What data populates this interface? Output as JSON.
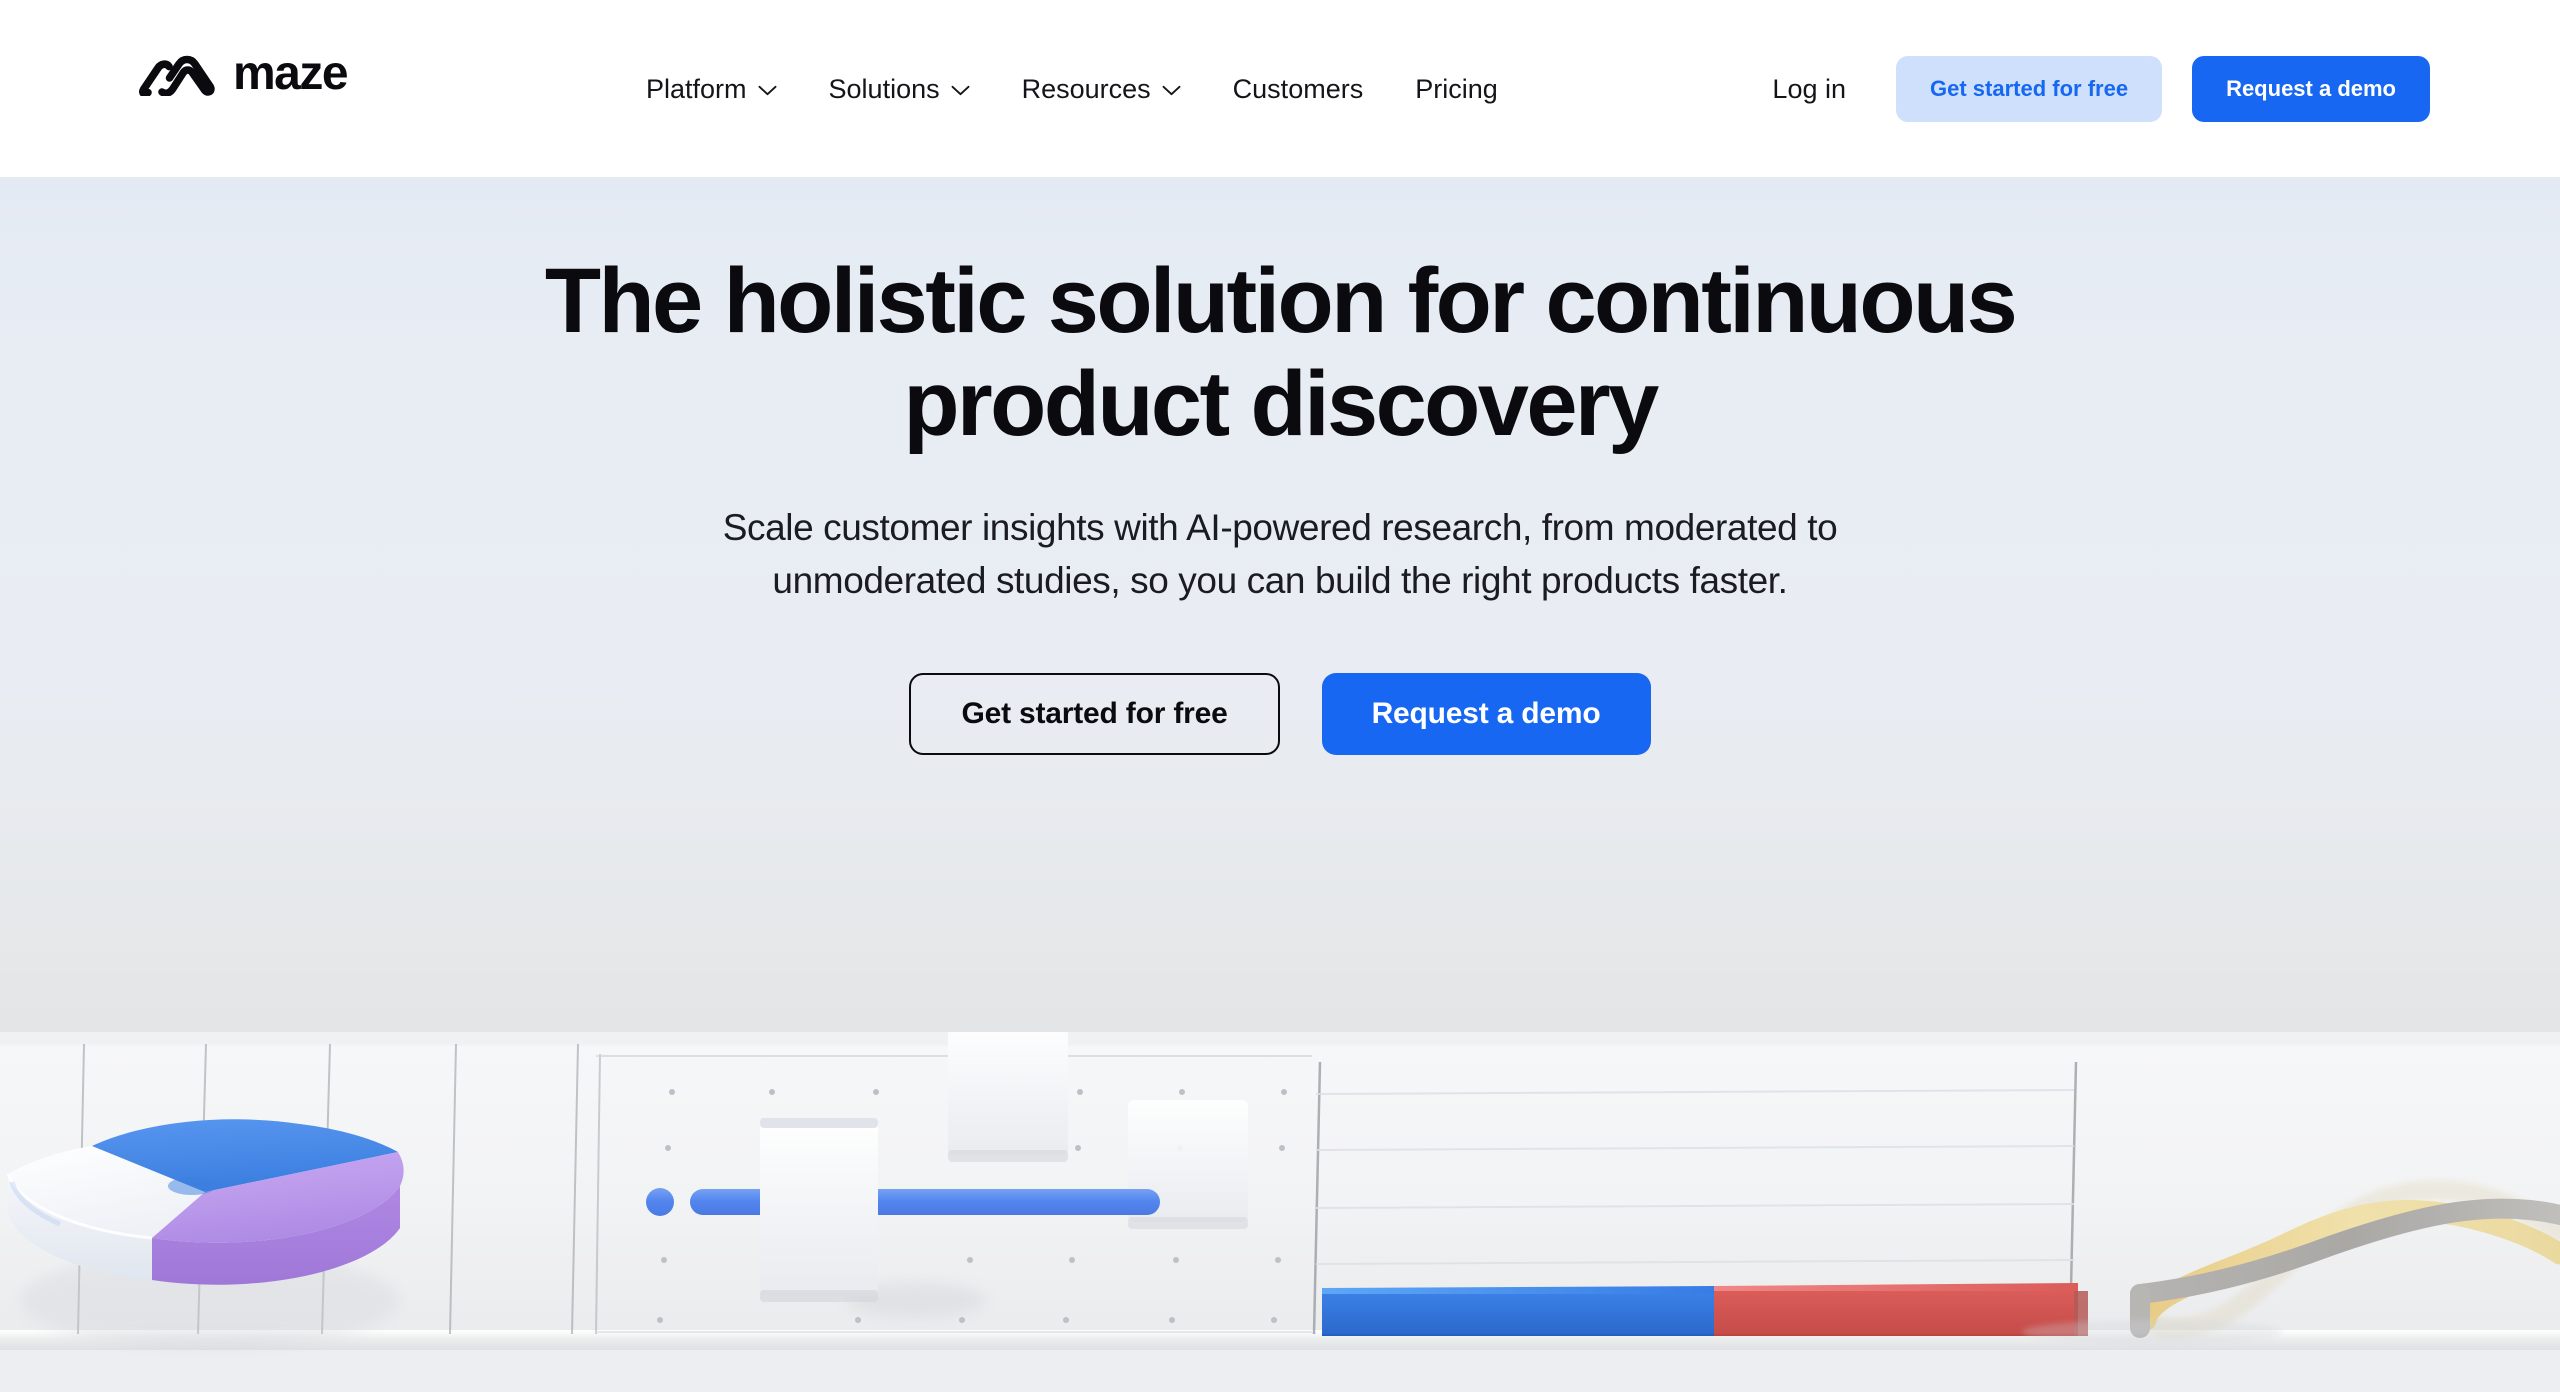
{
  "brand": {
    "name": "maze",
    "logo_icon": "maze-logo-icon",
    "accent_blue": "#1767f2",
    "soft_blue_bg": "#cfe0fd",
    "soft_blue_text": "#1668f0",
    "text_dark": "#0b0b0f",
    "hero_bg_top": "#e8edf4"
  },
  "header": {
    "nav_items": [
      {
        "label": "Platform",
        "has_dropdown": true,
        "icon": "chevron-down-icon"
      },
      {
        "label": "Solutions",
        "has_dropdown": true,
        "icon": "chevron-down-icon"
      },
      {
        "label": "Resources",
        "has_dropdown": true,
        "icon": "chevron-down-icon"
      },
      {
        "label": "Customers",
        "has_dropdown": false,
        "icon": ""
      },
      {
        "label": "Pricing",
        "has_dropdown": false,
        "icon": ""
      }
    ],
    "login_label": "Log in",
    "get_started_label": "Get started for free",
    "request_demo_label": "Request a demo"
  },
  "hero": {
    "title_line_1": "The holistic solution for continuous",
    "title_line_2": "product discovery",
    "subtitle_line_1": "Scale customer insights with AI-powered research, from moderated to",
    "subtitle_line_2": "unmoderated studies, so you can build the right products faster.",
    "cta_primary_outline": "Get started for free",
    "cta_primary_filled": "Request a demo"
  },
  "illustration": {
    "description": "3D render of abstract research data visualizations on a white platform",
    "elements": [
      {
        "name": "pie-chart-3d",
        "colors": [
          "#3f86e8",
          "#b08ce6",
          "#f4f5f7"
        ]
      },
      {
        "name": "slider-control-3d",
        "colors": [
          "#4d82ea",
          "#eef1f6"
        ]
      },
      {
        "name": "stacked-bar-chart-3d",
        "colors": [
          "#1b68e0",
          "#d9504f"
        ]
      },
      {
        "name": "line-graph-ribbons-3d",
        "colors": [
          "#ead79a",
          "#a09e9b"
        ]
      }
    ]
  }
}
